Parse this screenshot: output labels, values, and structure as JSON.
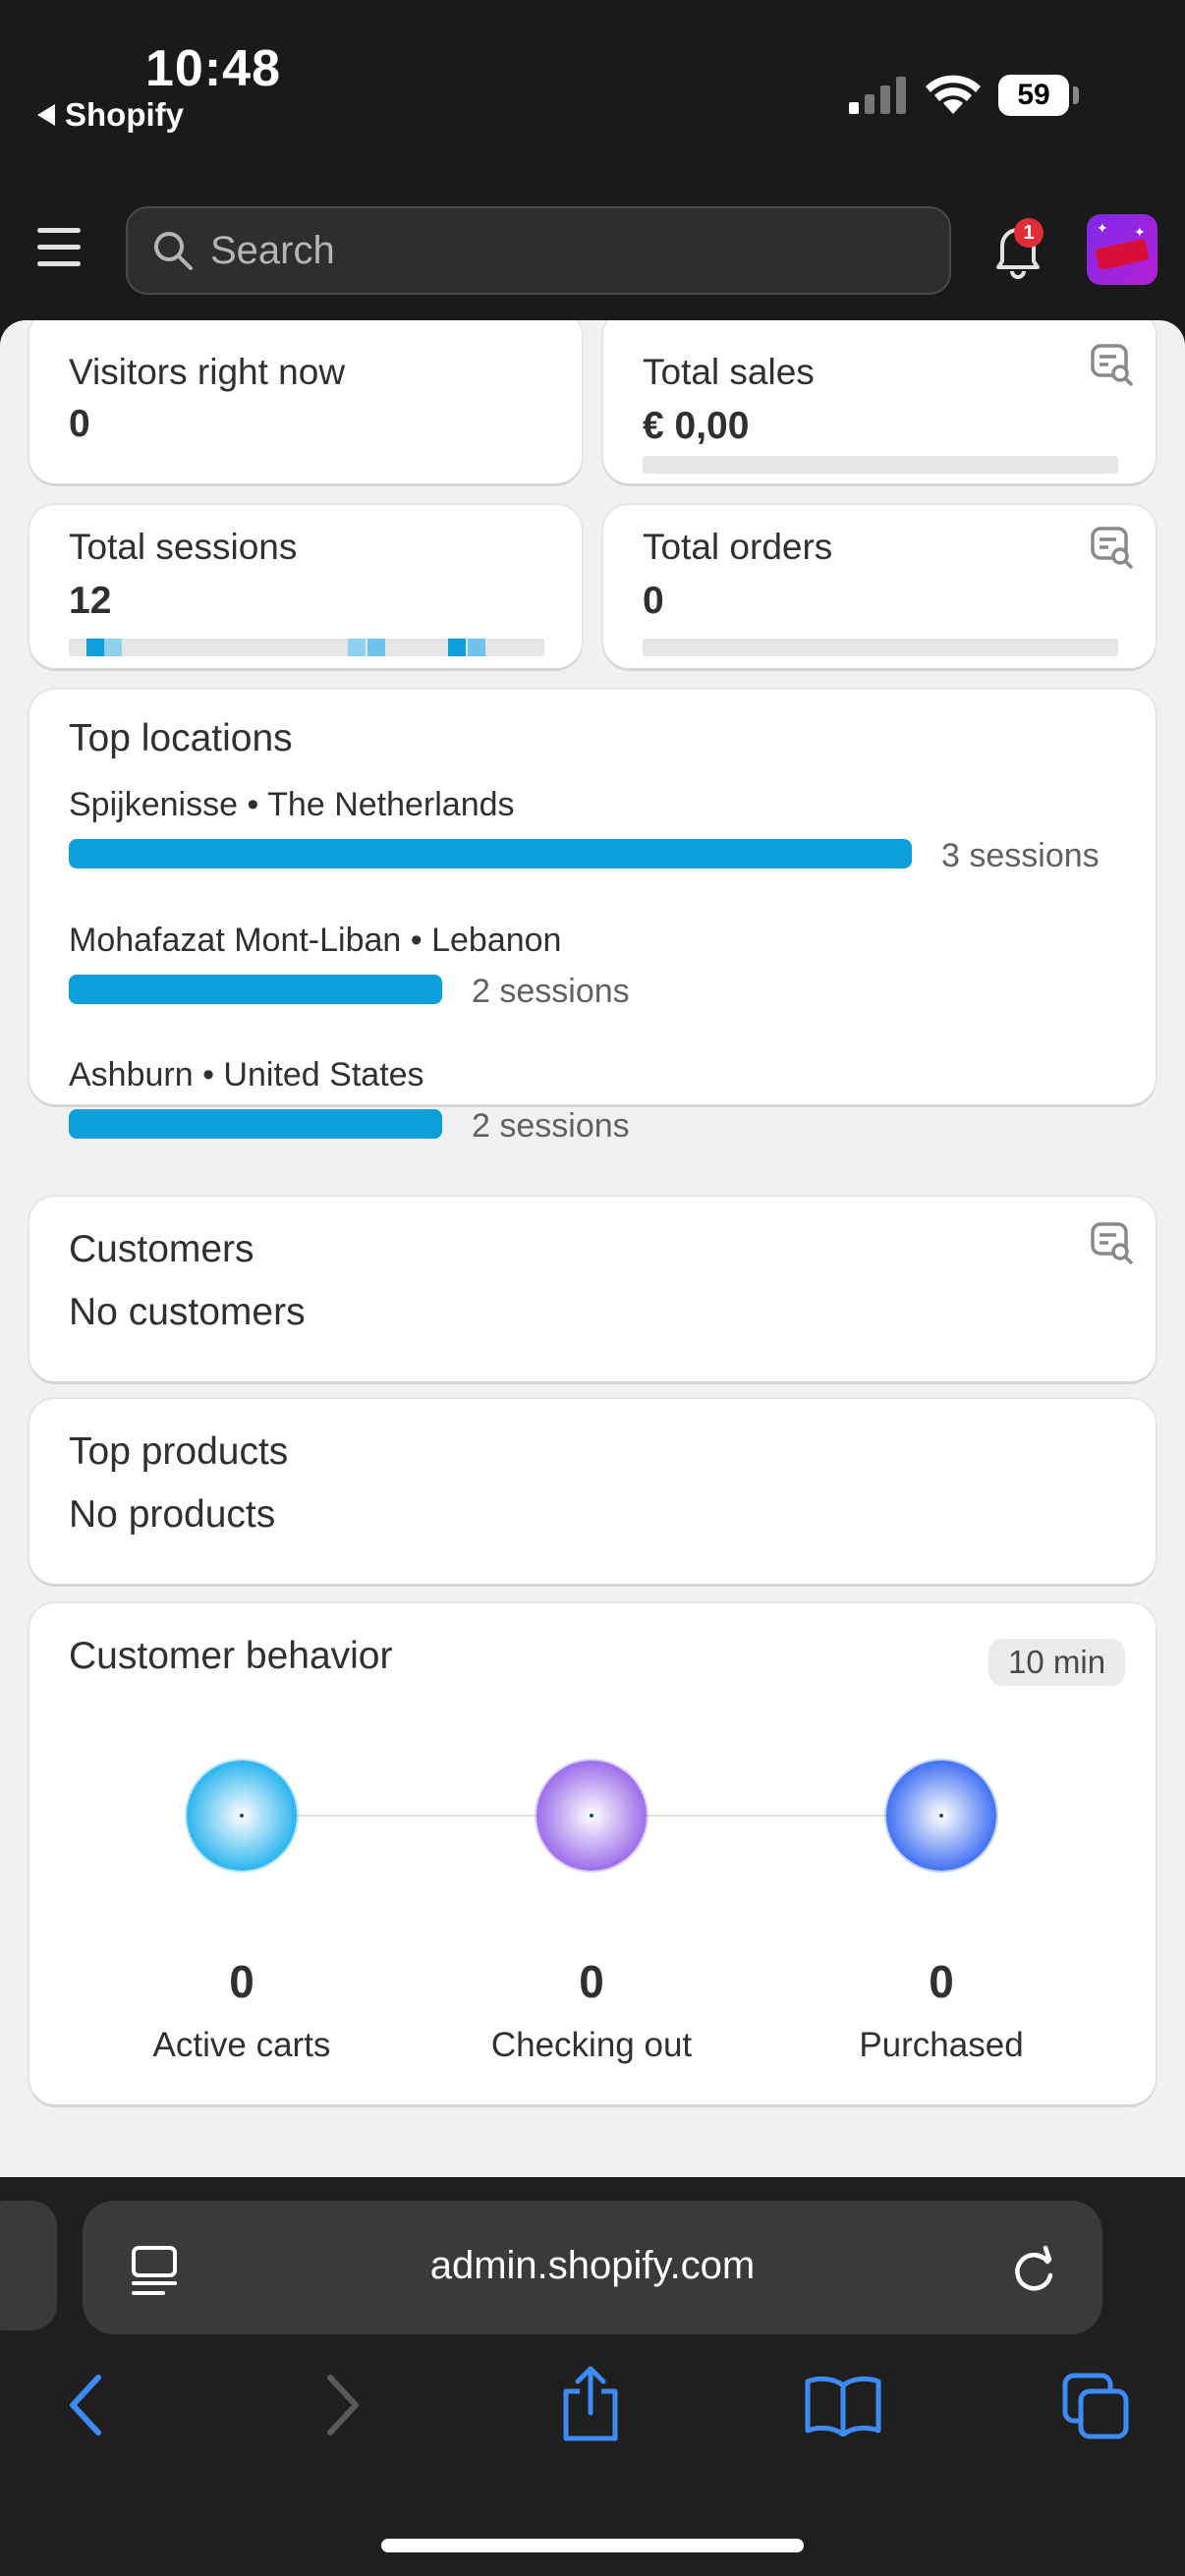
{
  "status_bar": {
    "time": "10:48",
    "back_app": "Shopify",
    "battery": "59"
  },
  "top_bar": {
    "search_placeholder": "Search",
    "notification_count": "1"
  },
  "stats": {
    "visitors": {
      "label": "Visitors right now",
      "value": "0"
    },
    "sales": {
      "label": "Total sales",
      "value": "€ 0,00"
    },
    "sessions": {
      "label": "Total sessions",
      "value": "12"
    },
    "orders": {
      "label": "Total orders",
      "value": "0"
    }
  },
  "top_locations": {
    "title": "Top locations",
    "items": [
      {
        "name": "Spijkenisse • The Netherlands",
        "count": "3 sessions",
        "sessions": 3
      },
      {
        "name": "Mohafazat Mont-Liban • Lebanon",
        "count": "2 sessions",
        "sessions": 2
      },
      {
        "name": "Ashburn • United States",
        "count": "2 sessions",
        "sessions": 2
      }
    ]
  },
  "customers": {
    "title": "Customers",
    "value": "No customers"
  },
  "top_products": {
    "title": "Top products",
    "value": "No products"
  },
  "customer_behavior": {
    "title": "Customer behavior",
    "period": "10 min",
    "stages": [
      {
        "value": "0",
        "label": "Active carts",
        "color": "#29b3ee"
      },
      {
        "value": "0",
        "label": "Checking out",
        "color": "#9a6bea"
      },
      {
        "value": "0",
        "label": "Purchased",
        "color": "#3f6ff2"
      }
    ]
  },
  "browser": {
    "url": "admin.shopify.com"
  },
  "colors": {
    "accent": "#0c9fdc",
    "badge": "#e22c38"
  }
}
